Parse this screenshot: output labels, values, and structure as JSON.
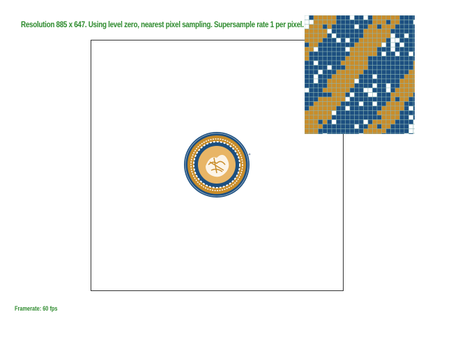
{
  "status": {
    "resolution_text": "Resolution 885 x 647. Using level zero, nearest pixel sampling. Supersample rate 1 per pixel."
  },
  "framerate": {
    "text": "Framerate: 60 fps"
  },
  "palette": {
    "navy": "#1c4f80",
    "gold": "#c98d2a",
    "light_gold": "#e8b566",
    "white": "#ffffff",
    "status_green": "#2e8b2e"
  },
  "viewport": {
    "image": "circular-seal-emblem"
  },
  "zoom": {
    "icon": "pixel-magnifier-grid"
  }
}
